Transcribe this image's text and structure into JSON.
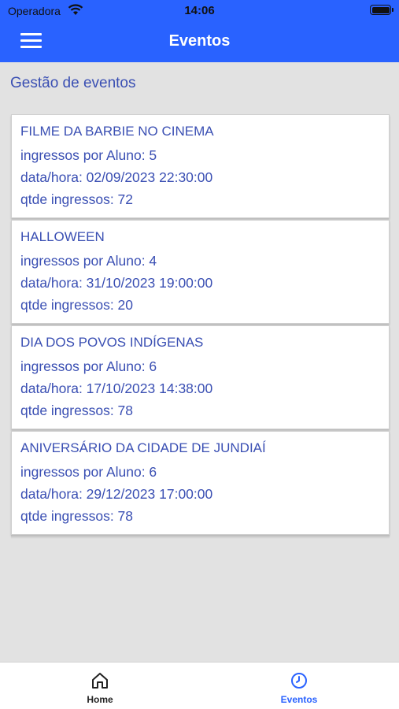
{
  "status_bar": {
    "carrier": "Operadora",
    "time": "14:06"
  },
  "app_bar": {
    "title": "Eventos"
  },
  "section": {
    "title": "Gestão de eventos"
  },
  "events": [
    {
      "name": "FILME DA BARBIE NO CINEMA",
      "ingressos_por_aluno": "ingressos por Aluno: 5",
      "data_hora": "data/hora: 02/09/2023 22:30:00",
      "qtde_ingressos": "qtde ingressos: 72"
    },
    {
      "name": "HALLOWEEN",
      "ingressos_por_aluno": "ingressos por Aluno: 4",
      "data_hora": "data/hora: 31/10/2023 19:00:00",
      "qtde_ingressos": "qtde ingressos: 20"
    },
    {
      "name": "DIA DOS POVOS INDÍGENAS",
      "ingressos_por_aluno": "ingressos por Aluno: 6",
      "data_hora": "data/hora: 17/10/2023 14:38:00",
      "qtde_ingressos": "qtde ingressos: 78"
    },
    {
      "name": "ANIVERSÁRIO DA CIDADE DE JUNDIAÍ",
      "ingressos_por_aluno": "ingressos por Aluno: 6",
      "data_hora": "data/hora: 29/12/2023 17:00:00",
      "qtde_ingressos": "qtde ingressos: 78"
    }
  ],
  "tab_bar": {
    "tabs": [
      {
        "label": "Home",
        "icon": "home-icon",
        "active": false
      },
      {
        "label": "Eventos",
        "icon": "clock-icon",
        "active": true
      }
    ]
  },
  "colors": {
    "primary": "#2962ff",
    "text_accent": "#3a4fb3",
    "background": "#e2e2e2"
  }
}
